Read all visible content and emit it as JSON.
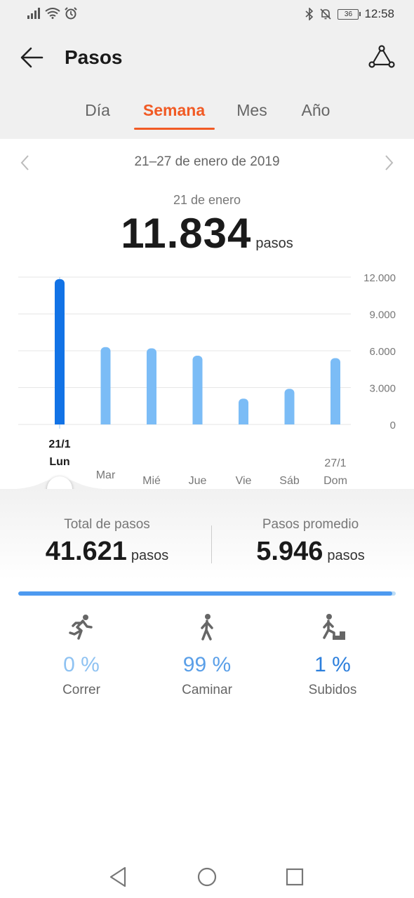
{
  "status_bar": {
    "time": "12:58",
    "battery": "36"
  },
  "header": {
    "title": "Pasos"
  },
  "tabs": [
    {
      "label": "Día",
      "active": false
    },
    {
      "label": "Semana",
      "active": true
    },
    {
      "label": "Mes",
      "active": false
    },
    {
      "label": "Año",
      "active": false
    }
  ],
  "range": {
    "label": "21–27 de enero de 2019"
  },
  "selected": {
    "date": "21 de enero",
    "value": "11.834",
    "unit": "pasos"
  },
  "chart_data": {
    "type": "bar",
    "categories": [
      "Lun",
      "Mar",
      "Mié",
      "Jue",
      "Vie",
      "Sáb",
      "Dom"
    ],
    "dates": [
      "21/1",
      "",
      "",
      "",
      "",
      "",
      "27/1"
    ],
    "values": [
      11834,
      6300,
      6200,
      5600,
      2100,
      2900,
      5400
    ],
    "selected_index": 0,
    "yticks": [
      0,
      3000,
      6000,
      9000,
      12000
    ],
    "ytick_labels": [
      "0",
      "3.000",
      "6.000",
      "9.000",
      "12.000"
    ],
    "ylim": [
      0,
      12000
    ],
    "colors": {
      "selected": "#1273e6",
      "normal": "#7bbcf6",
      "grid": "#e6e6e6"
    }
  },
  "summary": {
    "total_label": "Total de pasos",
    "total_value": "41.621",
    "total_unit": "pasos",
    "avg_label": "Pasos promedio",
    "avg_value": "5.946",
    "avg_unit": "pasos"
  },
  "distribution": {
    "run": 0.0,
    "walk": 0.99,
    "climb": 0.01
  },
  "activities": [
    {
      "pct": "0 %",
      "label": "Correr",
      "icon": "running-icon",
      "color": "#8ec2f2"
    },
    {
      "pct": "99 %",
      "label": "Caminar",
      "icon": "walking-icon",
      "color": "#5a9fe8"
    },
    {
      "pct": "1 %",
      "label": "Subidos",
      "icon": "climbing-icon",
      "color": "#2c7fdc"
    }
  ],
  "colors": {
    "accent": "#f15a24",
    "blue": "#1273e6"
  }
}
